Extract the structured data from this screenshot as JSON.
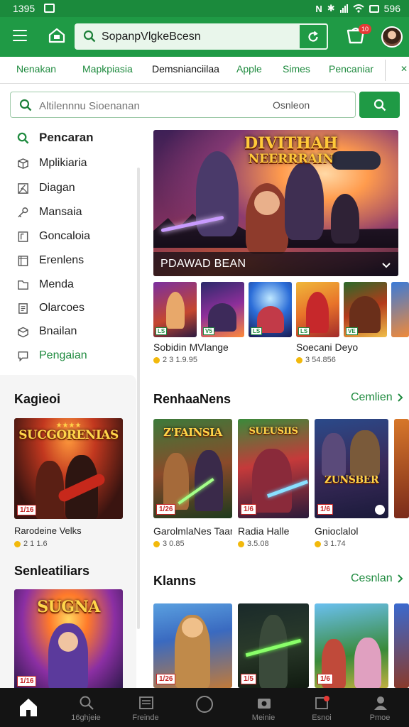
{
  "status_bar": {
    "time": "1395",
    "battery_text": "596"
  },
  "header": {
    "search_value": "SopanpVlgkeBcesn",
    "cart_badge": "10"
  },
  "tabs": [
    {
      "label": "Nenakan"
    },
    {
      "label": "Mapkpiasia"
    },
    {
      "label": "Demsnianciilaa"
    },
    {
      "label": "Apple"
    },
    {
      "label": "Simes"
    },
    {
      "label": "Pencaniar"
    }
  ],
  "search2": {
    "placeholder": "Altilennnu Sioenanan",
    "hint": "Osnleon"
  },
  "sidebar": {
    "items": [
      {
        "label": "Pencaran",
        "icon": "search-icon"
      },
      {
        "label": "Mplikiaria",
        "icon": "box-icon"
      },
      {
        "label": "Diagan",
        "icon": "image-icon"
      },
      {
        "label": "Mansaia",
        "icon": "key-icon"
      },
      {
        "label": "Goncaloia",
        "icon": "book-icon"
      },
      {
        "label": "Erenlens",
        "icon": "document-icon"
      },
      {
        "label": "Menda",
        "icon": "folder-icon"
      },
      {
        "label": "Olarcoes",
        "icon": "page-icon"
      },
      {
        "label": "Bnailan",
        "icon": "package-icon"
      },
      {
        "label": "Pengaian",
        "icon": "chat-icon"
      }
    ],
    "panel1": {
      "title": "Kagieoi",
      "tile_title": "SUCGORENIAS",
      "tile_age": "1/16",
      "app_name": "Rarodeine Velks",
      "price": "2 1 1.6"
    },
    "panel2": {
      "title": "Senleatiliars",
      "tile_title": "SUGNA",
      "tile_age": "1/16"
    }
  },
  "hero": {
    "title_line1": "DIVITHAH",
    "title_line2": "NEERRRAIN",
    "caption": "PDAWAD BEAN"
  },
  "strip": {
    "thumbs": [
      {
        "badge": "LS"
      },
      {
        "badge": "V5"
      },
      {
        "badge": "LS"
      },
      {
        "badge": "LS"
      },
      {
        "badge": "VE"
      }
    ],
    "left_name": "Sobidin MVlange",
    "left_price": "2 3 1.9.95",
    "right_name": "Soecani Deyo",
    "right_price": "3 54.856"
  },
  "section1": {
    "title": "RenhaaNens",
    "link": "Cemlien",
    "cards": [
      {
        "art": "Z'FAINSIA",
        "age": "1/26",
        "name": "GarolmlaNes Taan",
        "price": "3 0.85"
      },
      {
        "art": "SUEUSIIS",
        "age": "1/6",
        "name": "Radia Halle",
        "price": "3.5.08"
      },
      {
        "art": "ZUNSBER",
        "age": "1/6",
        "name": "Gnioclalol",
        "price": "3 1.74"
      }
    ]
  },
  "section2": {
    "title": "Klanns",
    "link": "Cesnlan",
    "cards": [
      {
        "age": "1/26"
      },
      {
        "age": "1/5"
      },
      {
        "age": "1/6"
      }
    ]
  },
  "bottom_nav": [
    {
      "label": "",
      "icon": "home-icon"
    },
    {
      "label": "16ghjeie",
      "icon": "search-icon"
    },
    {
      "label": "Freinde",
      "icon": "list-icon"
    },
    {
      "label": "",
      "icon": "circle-icon"
    },
    {
      "label": "Meinie",
      "icon": "games-icon"
    },
    {
      "label": "Esnoi",
      "icon": "notification-icon"
    },
    {
      "label": "Pmoe",
      "icon": "profile-icon"
    }
  ]
}
